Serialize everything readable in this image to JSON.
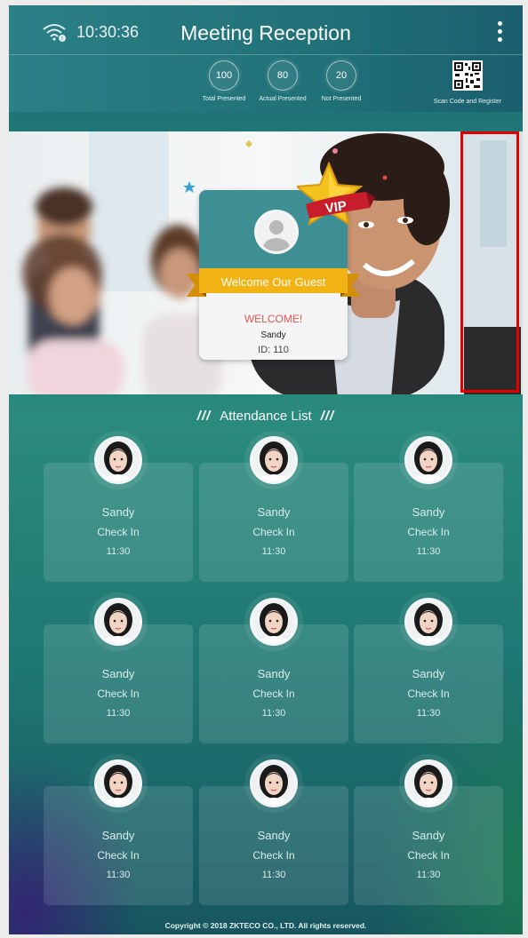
{
  "status_bar": {
    "time": "10:30:36",
    "wifi_icon": "wifi-icon",
    "menu_icon": "more-vertical-icon"
  },
  "header": {
    "title": "Meeting Reception"
  },
  "stats": [
    {
      "value": "100",
      "label": "Total Presented"
    },
    {
      "value": "80",
      "label": "Actual Presented"
    },
    {
      "value": "20",
      "label": "Not Presented"
    }
  ],
  "qr": {
    "icon": "qr-code-icon",
    "label": "Scan Code and Register"
  },
  "welcome_card": {
    "banner": "Welcome Our Guest",
    "greeting": "WELCOME!",
    "name": "Sandy",
    "id_text": "ID:  110",
    "badge": "VIP"
  },
  "attendance": {
    "title": "Attendance List",
    "slashes": "///",
    "entries": [
      {
        "name": "Sandy",
        "status": "Check In",
        "time": "11:30"
      },
      {
        "name": "Sandy",
        "status": "Check In",
        "time": "11:30"
      },
      {
        "name": "Sandy",
        "status": "Check In",
        "time": "11:30"
      },
      {
        "name": "Sandy",
        "status": "Check In",
        "time": "11:30"
      },
      {
        "name": "Sandy",
        "status": "Check In",
        "time": "11:30"
      },
      {
        "name": "Sandy",
        "status": "Check In",
        "time": "11:30"
      },
      {
        "name": "Sandy",
        "status": "Check In",
        "time": "11:30"
      },
      {
        "name": "Sandy",
        "status": "Check In",
        "time": "11:30"
      },
      {
        "name": "Sandy",
        "status": "Check In",
        "time": "11:30"
      }
    ]
  },
  "footer": {
    "copyright": "Copyright © 2018 ZKTECO CO., LTD. All rights reserved."
  },
  "colors": {
    "accent_teal": "#3e8f94",
    "ribbon_gold": "#f2b315",
    "welcome_red": "#e45454",
    "highlight_red": "#e00000"
  }
}
